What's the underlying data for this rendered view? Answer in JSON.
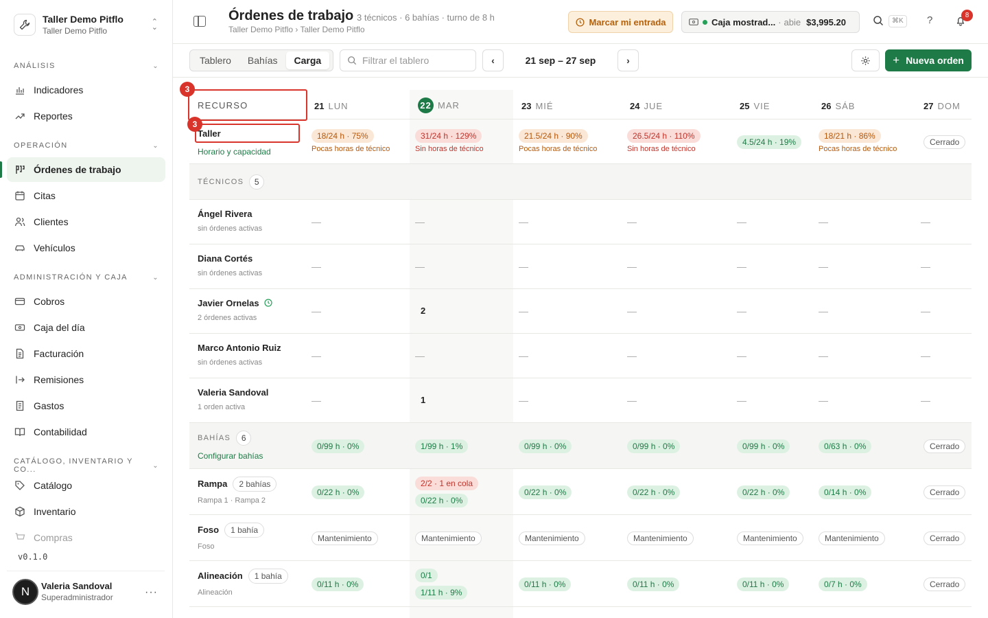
{
  "workspace": {
    "name": "Taller Demo Pitflo",
    "subtitle": "Taller Demo Pitflo"
  },
  "sidebar": {
    "sections": [
      {
        "title": "ANÁLISIS",
        "items": [
          {
            "label": "Indicadores",
            "icon": "bar-chart-icon"
          },
          {
            "label": "Reportes",
            "icon": "trend-icon"
          }
        ]
      },
      {
        "title": "OPERACIÓN",
        "items": [
          {
            "label": "Órdenes de trabajo",
            "icon": "kanban-icon",
            "active": true
          },
          {
            "label": "Citas",
            "icon": "calendar-icon"
          },
          {
            "label": "Clientes",
            "icon": "users-icon"
          },
          {
            "label": "Vehículos",
            "icon": "car-icon"
          }
        ]
      },
      {
        "title": "ADMINISTRACIÓN Y CAJA",
        "items": [
          {
            "label": "Cobros",
            "icon": "card-icon"
          },
          {
            "label": "Caja del día",
            "icon": "cash-icon"
          },
          {
            "label": "Facturación",
            "icon": "invoice-icon"
          },
          {
            "label": "Remisiones",
            "icon": "export-icon"
          },
          {
            "label": "Gastos",
            "icon": "receipt-icon"
          },
          {
            "label": "Contabilidad",
            "icon": "book-icon"
          }
        ]
      },
      {
        "title": "CATÁLOGO, INVENTARIO Y CO...",
        "items": [
          {
            "label": "Catálogo",
            "icon": "tag-icon"
          },
          {
            "label": "Inventario",
            "icon": "box-icon"
          },
          {
            "label": "Compras",
            "icon": "cart-icon"
          }
        ]
      }
    ],
    "version": "v0.1.0",
    "user": {
      "initial": "N",
      "name": "Valeria Sandoval",
      "role": "Superadministrador"
    }
  },
  "header": {
    "title": "Órdenes de trabajo",
    "meta": "3 técnicos · 6 bahías · turno de 8 h",
    "breadcrumb": "Taller Demo Pitflo › Taller Demo Pitflo",
    "entrada_label": "Marcar mi entrada",
    "caja": {
      "name": "Caja mostrad...",
      "sep": "·",
      "status": "abie",
      "amount": "$3,995.20"
    },
    "kbd": "⌘K",
    "notifications": "8"
  },
  "toolbar": {
    "tabs": [
      {
        "label": "Tablero"
      },
      {
        "label": "Bahías"
      },
      {
        "label": "Carga",
        "active": true
      }
    ],
    "filter_placeholder": "Filtrar el tablero",
    "range": "21 sep – 27 sep",
    "prev": "‹",
    "next": "›",
    "new_order": "Nueva orden"
  },
  "board": {
    "resource_header": "RECURSO",
    "days": [
      {
        "num": "21",
        "dow": "LUN"
      },
      {
        "num": "22",
        "dow": "MAR",
        "today": true
      },
      {
        "num": "23",
        "dow": "MIÉ"
      },
      {
        "num": "24",
        "dow": "JUE"
      },
      {
        "num": "25",
        "dow": "VIE"
      },
      {
        "num": "26",
        "dow": "SÁB"
      },
      {
        "num": "27",
        "dow": "DOM"
      }
    ],
    "taller": {
      "name": "Taller",
      "link": "Horario y capacidad",
      "cells": [
        {
          "pill": "18/24 h · 75%",
          "tone": "orange",
          "sub": "Pocas horas de técnico"
        },
        {
          "pill": "31/24 h · 129%",
          "tone": "red",
          "sub": "Sin horas de técnico"
        },
        {
          "pill": "21.5/24 h · 90%",
          "tone": "orange",
          "sub": "Pocas horas de técnico"
        },
        {
          "pill": "26.5/24 h · 110%",
          "tone": "red",
          "sub": "Sin horas de técnico"
        },
        {
          "pill": "4.5/24 h · 19%",
          "tone": "green",
          "sub": ""
        },
        {
          "pill": "18/21 h · 86%",
          "tone": "orange",
          "sub": "Pocas horas de técnico"
        },
        {
          "pill": "Cerrado",
          "tone": "gray",
          "sub": ""
        }
      ]
    },
    "tech_group": {
      "title": "TÉCNICOS",
      "count": "5"
    },
    "technicians": [
      {
        "name": "Ángel Rivera",
        "meta": "sin órdenes activas",
        "cells": [
          "—",
          "—",
          "—",
          "—",
          "—",
          "—",
          "—"
        ]
      },
      {
        "name": "Diana Cortés",
        "meta": "sin órdenes activas",
        "cells": [
          "—",
          "—",
          "—",
          "—",
          "—",
          "—",
          "—"
        ]
      },
      {
        "name": "Javier Ornelas",
        "meta": "2 órdenes activas",
        "clock": true,
        "cells": [
          "—",
          "2",
          "—",
          "—",
          "—",
          "—",
          "—"
        ]
      },
      {
        "name": "Marco Antonio Ruiz",
        "meta": "sin órdenes activas",
        "cells": [
          "—",
          "—",
          "—",
          "—",
          "—",
          "—",
          "—"
        ]
      },
      {
        "name": "Valeria Sandoval",
        "meta": "1 orden activa",
        "cells": [
          "—",
          "1",
          "—",
          "—",
          "—",
          "—",
          "—"
        ]
      }
    ],
    "bay_group": {
      "title": "BAHÍAS",
      "count": "6",
      "link": "Configurar bahías",
      "cells": [
        {
          "pill": "0/99 h · 0%",
          "tone": "green"
        },
        {
          "pill": "1/99 h · 1%",
          "tone": "green"
        },
        {
          "pill": "0/99 h · 0%",
          "tone": "green"
        },
        {
          "pill": "0/99 h · 0%",
          "tone": "green"
        },
        {
          "pill": "0/99 h · 0%",
          "tone": "green"
        },
        {
          "pill": "0/63 h · 0%",
          "tone": "green"
        },
        {
          "pill": "Cerrado",
          "tone": "gray"
        }
      ]
    },
    "bays": [
      {
        "name": "Rampa",
        "tag": "2 bahías",
        "meta": "Rampa 1 · Rampa 2",
        "cells": [
          [
            {
              "pill": "0/22 h · 0%",
              "tone": "green"
            }
          ],
          [
            {
              "pill": "2/2 · 1 en cola",
              "tone": "red"
            },
            {
              "pill": "0/22 h · 0%",
              "tone": "green"
            }
          ],
          [
            {
              "pill": "0/22 h · 0%",
              "tone": "green"
            }
          ],
          [
            {
              "pill": "0/22 h · 0%",
              "tone": "green"
            }
          ],
          [
            {
              "pill": "0/22 h · 0%",
              "tone": "green"
            }
          ],
          [
            {
              "pill": "0/14 h · 0%",
              "tone": "green"
            }
          ],
          [
            {
              "pill": "Cerrado",
              "tone": "gray"
            }
          ]
        ]
      },
      {
        "name": "Foso",
        "tag": "1 bahía",
        "meta": "Foso",
        "cells": [
          [
            {
              "pill": "Mantenimiento",
              "tone": "gray"
            }
          ],
          [
            {
              "pill": "Mantenimiento",
              "tone": "gray"
            }
          ],
          [
            {
              "pill": "Mantenimiento",
              "tone": "gray"
            }
          ],
          [
            {
              "pill": "Mantenimiento",
              "tone": "gray"
            }
          ],
          [
            {
              "pill": "Mantenimiento",
              "tone": "gray"
            }
          ],
          [
            {
              "pill": "Mantenimiento",
              "tone": "gray"
            }
          ],
          [
            {
              "pill": "Cerrado",
              "tone": "gray"
            }
          ]
        ]
      },
      {
        "name": "Alineación",
        "tag": "1 bahía",
        "meta": "Alineación",
        "cells": [
          [
            {
              "pill": "0/11 h · 0%",
              "tone": "green"
            }
          ],
          [
            {
              "pill": "0/1",
              "tone": "green"
            },
            {
              "pill": "1/11 h · 9%",
              "tone": "green"
            }
          ],
          [
            {
              "pill": "0/11 h · 0%",
              "tone": "green"
            }
          ],
          [
            {
              "pill": "0/11 h · 0%",
              "tone": "green"
            }
          ],
          [
            {
              "pill": "0/11 h · 0%",
              "tone": "green"
            }
          ],
          [
            {
              "pill": "0/7 h · 0%",
              "tone": "green"
            }
          ],
          [
            {
              "pill": "Cerrado",
              "tone": "gray"
            }
          ]
        ]
      }
    ],
    "annotation_number": "3",
    "colors": {
      "accent": "#1e7a46",
      "annotation": "#d9342b"
    }
  }
}
